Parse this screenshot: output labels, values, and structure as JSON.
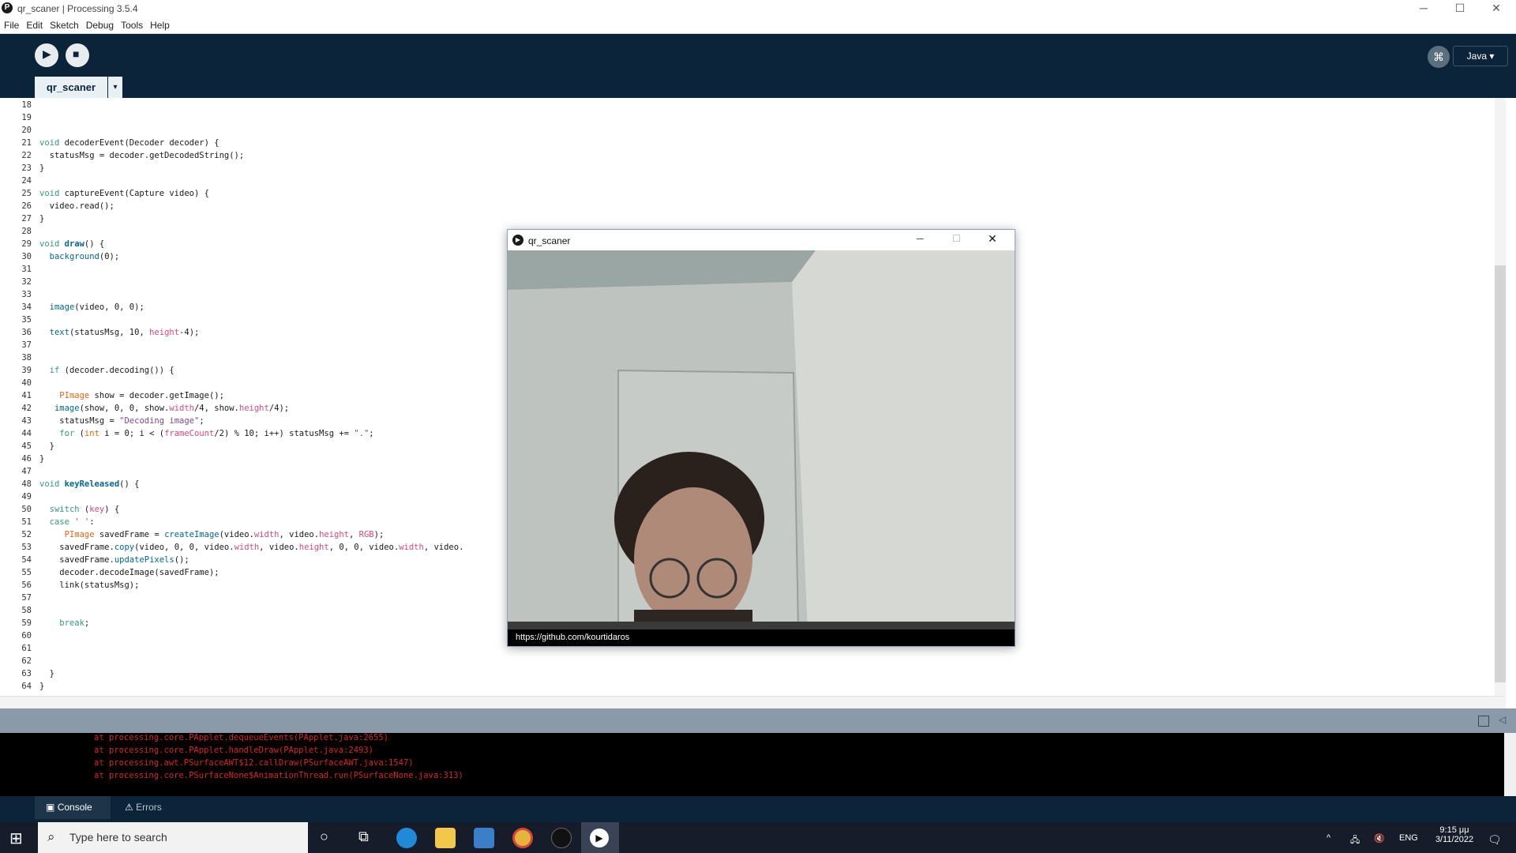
{
  "window": {
    "title": "qr_scaner | Processing 3.5.4",
    "logo_glyph": "P",
    "controls": {
      "minimize": "─",
      "maximize": "☐",
      "close": "✕"
    }
  },
  "menu": [
    "File",
    "Edit",
    "Sketch",
    "Debug",
    "Tools",
    "Help"
  ],
  "toolbar": {
    "run_icon": "▶",
    "stop_icon": "■",
    "debug_icon": "⌘",
    "mode_label": "Java ▾"
  },
  "editor_tab": {
    "label": "qr_scaner",
    "menu_arrow": "▾"
  },
  "line_numbers": [
    "18",
    "19",
    "20",
    "21",
    "22",
    "23",
    "24",
    "25",
    "26",
    "27",
    "28",
    "29",
    "30",
    "31",
    "32",
    "33",
    "34",
    "35",
    "36",
    "37",
    "38",
    "39",
    "40",
    "41",
    "42",
    "43",
    "44",
    "45",
    "46",
    "47",
    "48",
    "49",
    "50",
    "51",
    "52",
    "53",
    "54",
    "55",
    "56",
    "57",
    "58",
    "59",
    "60",
    "61",
    "62",
    "63",
    "64"
  ],
  "code": {
    "l21a": "void ",
    "l21b": "decoderEvent",
    "l21c": "(Decoder decoder) {",
    "l22": "  statusMsg = decoder.getDecodedString();",
    "l23": "}",
    "l25a": "void ",
    "l25b": "captureEvent",
    "l25c": "(Capture video) {",
    "l26": "  video.read();",
    "l27": "}",
    "l29a": "void ",
    "l29b": "draw",
    "l29c": "() {",
    "l30a": "  ",
    "l30b": "background",
    "l30c": "(0);",
    "l34a": "  ",
    "l34b": "image",
    "l34c": "(video, 0, 0);",
    "l36a": "  ",
    "l36b": "text",
    "l36c": "(statusMsg, 10, ",
    "l36d": "height",
    "l36e": "-4);",
    "l39a": "  ",
    "l39b": "if",
    "l39c": " (decoder.decoding()) {",
    "l41a": "    ",
    "l41b": "PImage",
    "l41c": " show = decoder.getImage();",
    "l42a": "   ",
    "l42b": "image",
    "l42c": "(show, 0, 0, show.",
    "l42d": "width",
    "l42e": "/4, show.",
    "l42f": "height",
    "l42g": "/4);",
    "l43a": "    statusMsg = ",
    "l43b": "\"Decoding image\"",
    "l43c": ";",
    "l44a": "    ",
    "l44b": "for",
    "l44c": " (",
    "l44d": "int",
    "l44e": " i = 0; i < (",
    "l44f": "frameCount",
    "l44g": "/2) % 10; i++) statusMsg += ",
    "l44h": "\".\"",
    "l44i": ";",
    "l45": "  }",
    "l46": "}",
    "l48a": "void ",
    "l48b": "keyReleased",
    "l48c": "() {",
    "l50a": "  ",
    "l50b": "switch",
    "l50c": " (",
    "l50d": "key",
    "l50e": ") {",
    "l51a": "  ",
    "l51b": "case",
    "l51c": " ",
    "l51d": "' '",
    "l51e": ":",
    "l52a": "     ",
    "l52b": "PImage",
    "l52c": " savedFrame = ",
    "l52d": "createImage",
    "l52e": "(video.",
    "l52f": "width",
    "l52g": ", video.",
    "l52h": "height",
    "l52i": ", ",
    "l52j": "RGB",
    "l52k": ");",
    "l53a": "    savedFrame.",
    "l53b": "copy",
    "l53c": "(video, 0, 0, video.",
    "l53d": "width",
    "l53e": ", video.",
    "l53f": "height",
    "l53g": ", 0, 0, video.",
    "l53h": "width",
    "l53i": ", video.",
    "l54a": "    savedFrame.",
    "l54b": "updatePixels",
    "l54c": "();",
    "l55": "    decoder.decodeImage(savedFrame);",
    "l56": "    link(statusMsg);",
    "l59a": "    ",
    "l59b": "break",
    "l59c": ";",
    "l63": "  }",
    "l64": "}"
  },
  "console_lines": [
    "at processing.core.PApplet.dequeueEvents(PApplet.java:2655)",
    "at processing.core.PApplet.handleDraw(PApplet.java:2493)",
    "at processing.awt.PSurfaceAWT$12.callDraw(PSurfaceAWT.java:1547)",
    "at processing.core.PSurfaceNone$AnimationThread.run(PSurfaceNone.java:313)"
  ],
  "console_tabs": {
    "console": "Console",
    "errors": "Errors",
    "console_icon": "▣",
    "errors_icon": "⚠"
  },
  "sketch_window": {
    "title": "qr_scaner",
    "icon_glyph": "▶",
    "status_text": "https://github.com/kourtidaros",
    "controls": {
      "minimize": "─",
      "maximize": "☐",
      "close": "✕"
    }
  },
  "taskbar": {
    "start_icon": "⊞",
    "search_placeholder": "Type here to search",
    "search_icon": "⌕",
    "cortana_icon": "○",
    "taskview_icon": "⧉",
    "tray_up": "^",
    "tray_net": "🖧",
    "tray_vol": "🔇",
    "lang": "ENG",
    "time": "9:15 μμ",
    "date": "3/11/2022",
    "notify_icon": "🗨"
  },
  "colors": {
    "toolbar_bg": "#0c2439",
    "keyword": "#33997e",
    "function": "#006699",
    "type": "#e2661a",
    "string": "#7d4793",
    "builtin_var": "#d94a7a",
    "console_error": "#d9232a"
  }
}
